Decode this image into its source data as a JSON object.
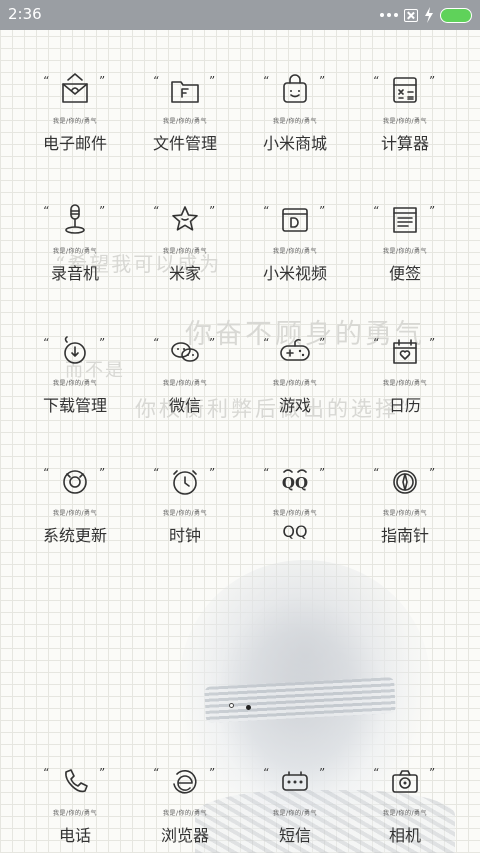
{
  "status_bar": {
    "time": "2:36",
    "battery_color": "#5fd25a"
  },
  "background": {
    "quote_line1": "“希望我可以成为",
    "quote_line2": "你奋不顾身的勇气",
    "quote_line3": "而不是",
    "quote_line4": "你权衡利弊后做出的选择”"
  },
  "icon_caption": "我是/你的/勇气",
  "apps": [
    {
      "label": "电子邮件",
      "icon": "mail-icon"
    },
    {
      "label": "文件管理",
      "icon": "folder-icon"
    },
    {
      "label": "小米商城",
      "icon": "shopping-bag-icon"
    },
    {
      "label": "计算器",
      "icon": "calculator-icon"
    },
    {
      "label": "录音机",
      "icon": "microphone-icon"
    },
    {
      "label": "米家",
      "icon": "star-icon"
    },
    {
      "label": "小米视频",
      "icon": "video-icon"
    },
    {
      "label": "便签",
      "icon": "notes-icon"
    },
    {
      "label": "下载管理",
      "icon": "download-icon"
    },
    {
      "label": "微信",
      "icon": "wechat-icon"
    },
    {
      "label": "游戏",
      "icon": "gamepad-icon"
    },
    {
      "label": "日历",
      "icon": "calendar-icon"
    },
    {
      "label": "系统更新",
      "icon": "update-icon"
    },
    {
      "label": "时钟",
      "icon": "clock-icon"
    },
    {
      "label": "QQ",
      "icon": "qq-icon"
    },
    {
      "label": "指南针",
      "icon": "compass-icon"
    }
  ],
  "dock": [
    {
      "label": "电话",
      "icon": "phone-icon"
    },
    {
      "label": "浏览器",
      "icon": "browser-icon"
    },
    {
      "label": "短信",
      "icon": "message-icon"
    },
    {
      "label": "相机",
      "icon": "camera-icon"
    }
  ]
}
